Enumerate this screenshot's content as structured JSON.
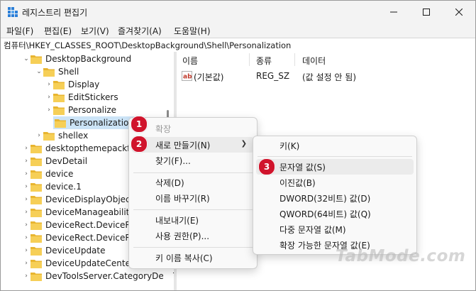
{
  "window": {
    "title": "레지스트리 편집기"
  },
  "menubar": {
    "items": [
      "파일(F)",
      "편집(E)",
      "보기(V)",
      "즐겨찾기(A)",
      "도움말(H)"
    ]
  },
  "address": {
    "path": "컴퓨터\\HKEY_CLASSES_ROOT\\DesktopBackground\\Shell\\Personalization"
  },
  "tree": {
    "items": [
      {
        "label": "DesktopBackground"
      },
      {
        "label": "Shell"
      },
      {
        "label": "Display"
      },
      {
        "label": "EditStickers"
      },
      {
        "label": "Personalize"
      },
      {
        "label": "Personalization"
      },
      {
        "label": "shellex"
      },
      {
        "label": "desktopthemepackfil"
      },
      {
        "label": "DevDetail"
      },
      {
        "label": "device"
      },
      {
        "label": "device.1"
      },
      {
        "label": "DeviceDisplayObject"
      },
      {
        "label": "DeviceManageability"
      },
      {
        "label": "DeviceRect.DeviceRe"
      },
      {
        "label": "DeviceRect.DeviceRe"
      },
      {
        "label": "DeviceUpdate"
      },
      {
        "label": "DeviceUpdateCenter"
      },
      {
        "label": "DevToolsServer.CategoryDevT"
      }
    ]
  },
  "list": {
    "headers": {
      "name": "이름",
      "type": "종류",
      "data": "데이터"
    },
    "rows": [
      {
        "name": "(기본값)",
        "type": "REG_SZ",
        "data": "(값 설정 안 됨)",
        "icon": "string-value-icon"
      }
    ]
  },
  "context_menu": {
    "items": [
      "확장",
      "새로 만들기(N)",
      "찾기(F)...",
      "삭제(D)",
      "이름 바꾸기(R)",
      "내보내기(E)",
      "사용 권한(P)...",
      "키 이름 복사(C)"
    ]
  },
  "submenu": {
    "items": [
      "키(K)",
      "문자열 값(S)",
      "이진값(B)",
      "DWORD(32비트) 값(D)",
      "QWORD(64비트) 값(Q)",
      "다중 문자열 값(M)",
      "확장 가능한 문자열 값(E)"
    ]
  },
  "badges": [
    "1",
    "2",
    "3"
  ],
  "watermark": "TabMode.com",
  "colors": {
    "badge": "#d0142c",
    "selection": "#cce4f7",
    "folder": "#f4c542"
  }
}
